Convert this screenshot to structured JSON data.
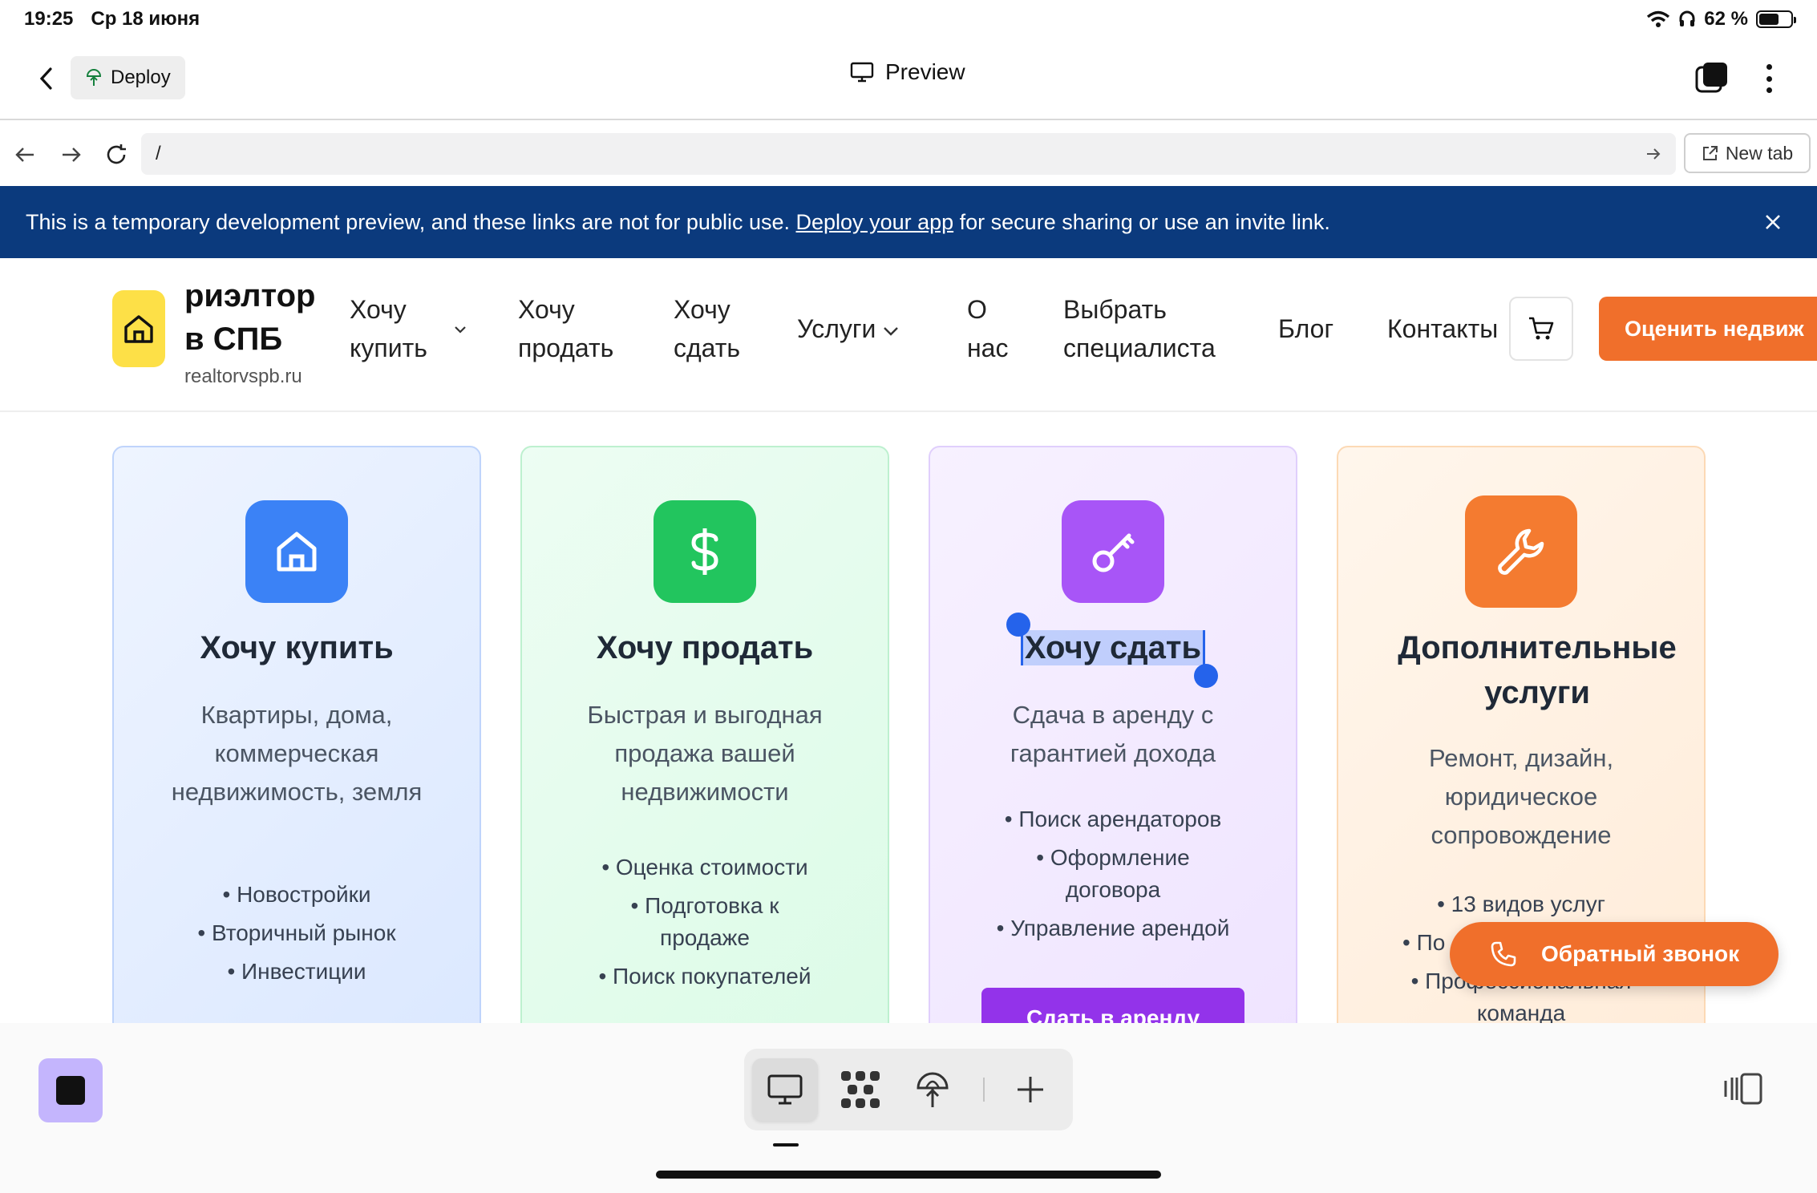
{
  "status": {
    "time": "19:25",
    "date": "Ср 18 июня",
    "battery": "62 %",
    "battery_level": 0.62
  },
  "appbar": {
    "deploy_label": "Deploy",
    "preview_label": "Preview"
  },
  "browser": {
    "url": "/",
    "new_tab_label": "New tab"
  },
  "banner": {
    "text_before": "This is a temporary development preview, and these links are not for public use.",
    "link": "Deploy your app",
    "text_after": "for secure sharing or use an invite link."
  },
  "site": {
    "brand_line1": "риэлтор",
    "brand_line2": "в СПБ",
    "domain": "realtorvspb.ru",
    "nav": {
      "buy_1": "Хочу",
      "buy_2": "купить",
      "sell_1": "Хочу",
      "sell_2": "продать",
      "rent_1": "Хочу",
      "rent_2": "сдать",
      "services": "Услуги",
      "about_1": "О",
      "about_2": "нас",
      "specialist_1": "Выбрать",
      "specialist_2": "специалиста",
      "blog": "Блог",
      "contacts": "Контакты"
    },
    "cta": "Оценить недвиж"
  },
  "cards": [
    {
      "title": "Хочу купить",
      "desc": "Квартиры, дома, коммерческая недвижимость, земля",
      "items": [
        "• Новостройки",
        "• Вторичный рынок",
        "• Инвестиции"
      ]
    },
    {
      "title": "Хочу продать",
      "desc": "Быстрая и выгодная продажа вашей недвижимости",
      "items": [
        "• Оценка стоимости",
        "• Подготовка к продаже",
        "• Поиск покупателей"
      ]
    },
    {
      "title": "Хочу сдать",
      "desc": "Сдача в аренду с гарантией дохода",
      "items": [
        "• Поиск арендаторов",
        "• Оформление договора",
        "• Управление арендой"
      ],
      "button": "Сдать в аренду"
    },
    {
      "title": "Дополнительные услуги",
      "desc": "Ремонт, дизайн, юридическое сопровождение",
      "items": [
        "• 13 видов услуг",
        "• По",
        "• Профессиональная команда"
      ]
    }
  ],
  "callback_label": "Обратный звонок",
  "colors": {
    "banner": "#0b3a7d",
    "accent_orange": "#f06f2b",
    "blue": "#3b82f6",
    "green": "#22c55e",
    "purple": "#a855f7",
    "orange": "#f47b30"
  }
}
